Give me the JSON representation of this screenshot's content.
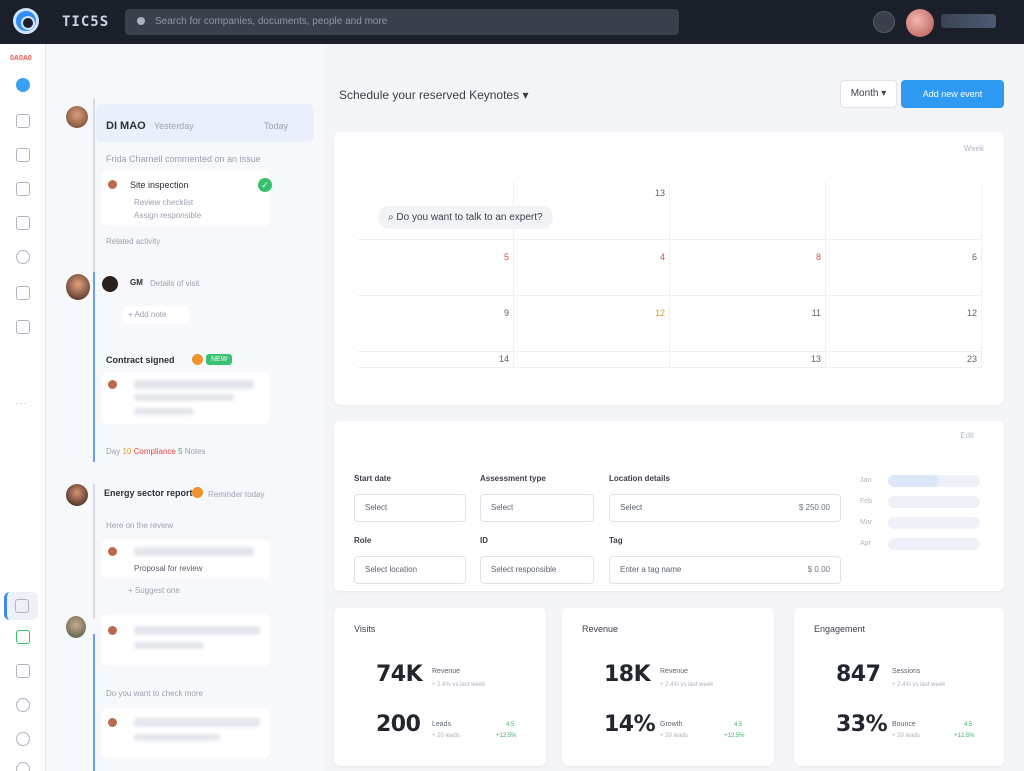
{
  "app": {
    "brand": "TIC5S",
    "search_placeholder": "Search for companies, documents, people and more"
  },
  "rail": {
    "top_label": "0A0A0",
    "items": [
      "home",
      "calendar",
      "people",
      "chat",
      "files",
      "clock",
      "lock",
      "docs"
    ],
    "more": "..."
  },
  "feed": {
    "entries": [
      {
        "title": "DI MAO",
        "meta": "Yesterday",
        "right": "Today",
        "line": "Frida Charnell commented on an issue",
        "item_title": "Site inspection",
        "item_lines": [
          "Review checklist",
          "Assign responsible"
        ],
        "footer": "Related activity"
      },
      {
        "title": "GM",
        "meta": "Details of visit",
        "chip": "+ Add note",
        "line": "Contract signed",
        "badge": "NEW",
        "footer_parts": [
          "Day",
          "10",
          "Compliance",
          "5",
          "Notes"
        ]
      },
      {
        "title": "Energy sector report",
        "meta": "Reminder today",
        "line": "Here on the review",
        "item_title": "Proposal for review",
        "footer": "+ Suggest one"
      },
      {
        "title": "",
        "line": "Do you want to check more",
        "footer": ""
      }
    ]
  },
  "main": {
    "title": "Schedule your reserved Keynotes",
    "secondary_button": "Month",
    "primary_button": "Add new event",
    "calendar": {
      "controls": "Week",
      "tip": "Do you want to talk to an expert?",
      "header_day": "13",
      "rows": [
        [
          {
            "n": "5",
            "c": "red"
          },
          {
            "n": "4",
            "c": "red"
          },
          {
            "n": "8",
            "c": "red"
          },
          {
            "n": "6",
            "c": ""
          }
        ],
        [
          {
            "n": "9",
            "c": ""
          },
          {
            "n": "12",
            "c": "amber"
          },
          {
            "n": "11",
            "c": ""
          },
          {
            "n": "12",
            "c": ""
          }
        ],
        [
          {
            "n": "14",
            "c": ""
          },
          {
            "n": "",
            "c": ""
          },
          {
            "n": "13",
            "c": ""
          },
          {
            "n": "23",
            "c": ""
          }
        ]
      ]
    },
    "form": {
      "controls": "Edit",
      "fields": [
        {
          "label": "Start date",
          "value": "Select"
        },
        {
          "label": "Assessment type",
          "value": "Select"
        },
        {
          "label": "Location details",
          "value": "Select",
          "suffix": "$ 250.00"
        },
        {
          "label": "Role",
          "value": "Select location"
        },
        {
          "label": "ID",
          "value": "Select responsible"
        },
        {
          "label": "Tag",
          "value": "Enter a tag name",
          "suffix": "$ 0.00"
        }
      ],
      "bars": [
        {
          "label": "Jan",
          "fill": 0.55
        },
        {
          "label": "Feb",
          "fill": 0.0
        },
        {
          "label": "Mar",
          "fill": 0.0
        },
        {
          "label": "Apr",
          "fill": 0.0
        }
      ]
    },
    "stats": [
      {
        "title": "Visits",
        "big1": "74K",
        "cap1": "Revenue",
        "sub1": "+ 2.4% vs last week",
        "big2": "200",
        "cap2": "Leads",
        "sub2": "+ 20 leads",
        "trend_top": "4.5",
        "trend_bot": "+12.5%"
      },
      {
        "title": "Revenue",
        "big1": "18K",
        "cap1": "Revenue",
        "sub1": "+ 2.4% vs last week",
        "big2": "14%",
        "cap2": "Growth",
        "sub2": "+ 20 leads",
        "trend_top": "4.5",
        "trend_bot": "+12.5%"
      },
      {
        "title": "Engagement",
        "big1": "847",
        "cap1": "Sessions",
        "sub1": "+ 2.4% vs last week",
        "big2": "33%",
        "cap2": "Bounce",
        "sub2": "+ 20 leads",
        "trend_top": "4.5",
        "trend_bot": "+12.5%"
      }
    ]
  }
}
